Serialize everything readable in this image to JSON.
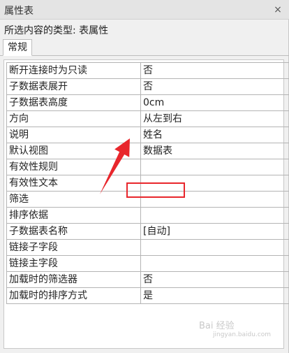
{
  "panel": {
    "title": "属性表",
    "close_symbol": "×",
    "selection_type": "所选内容的类型: 表属性"
  },
  "tabs": [
    {
      "label": "常规",
      "active": true
    }
  ],
  "properties": [
    {
      "name": "断开连接时为只读",
      "value": "否"
    },
    {
      "name": "子数据表展开",
      "value": "否"
    },
    {
      "name": "子数据表高度",
      "value": "0cm"
    },
    {
      "name": "方向",
      "value": "从左到右"
    },
    {
      "name": "说明",
      "value": "姓名"
    },
    {
      "name": "默认视图",
      "value": "数据表"
    },
    {
      "name": "有效性规则",
      "value": ""
    },
    {
      "name": "有效性文本",
      "value": ""
    },
    {
      "name": "筛选",
      "value": ""
    },
    {
      "name": "排序依据",
      "value": ""
    },
    {
      "name": "子数据表名称",
      "value": "[自动]"
    },
    {
      "name": "链接子字段",
      "value": ""
    },
    {
      "name": "链接主字段",
      "value": ""
    },
    {
      "name": "加载时的筛选器",
      "value": "否"
    },
    {
      "name": "加载时的排序方式",
      "value": "是"
    }
  ],
  "annotation": {
    "highlighted_property": "说明",
    "color": "#e8262c"
  },
  "watermark": {
    "text": "Bai 经验",
    "url": "jingyan.baidu.com"
  }
}
